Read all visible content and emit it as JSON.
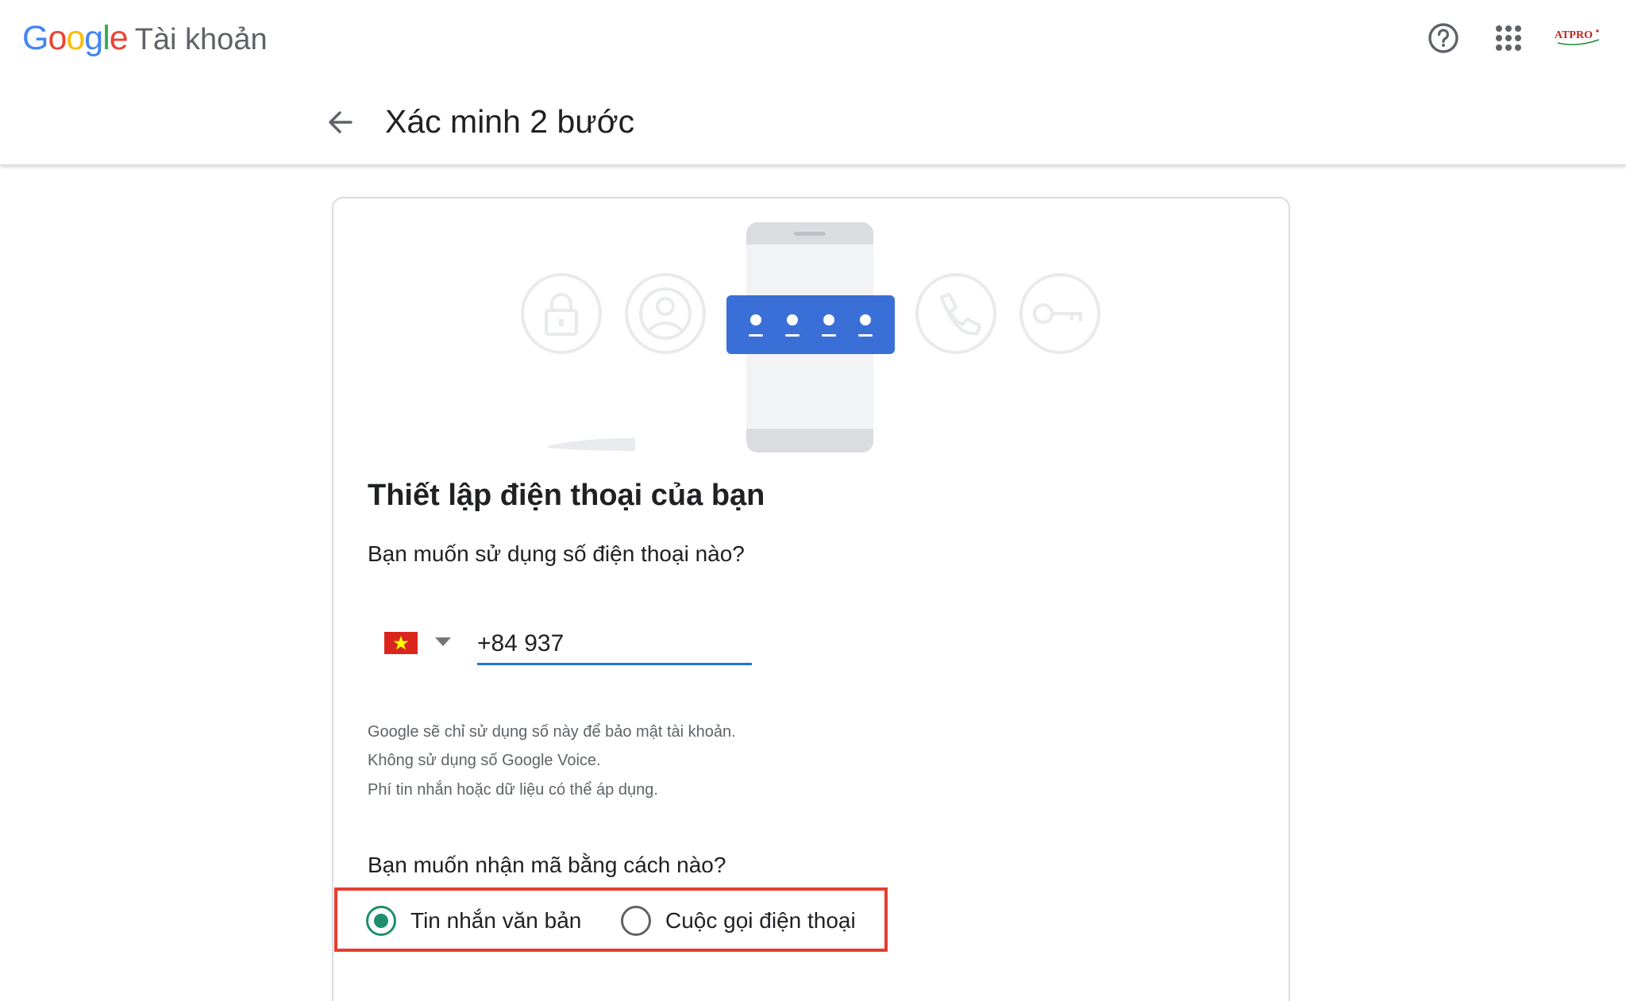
{
  "header": {
    "logo": "Google",
    "product": "Tài khoản",
    "account_badge": "ATPRO"
  },
  "page": {
    "back_label": "←",
    "title": "Xác minh 2 bước"
  },
  "content": {
    "heading": "Thiết lập điện thoại của bạn",
    "phone_question": "Bạn muốn sử dụng số điện thoại nào?",
    "country": "Vietnam",
    "phone_value": "+84 937",
    "notes": [
      "Google sẽ chỉ sử dụng số này để bảo mật tài khoản.",
      "Không sử dụng số Google Voice.",
      "Phí tin nhắn hoặc dữ liệu có thể áp dụng."
    ],
    "code_question": "Bạn muốn nhận mã bằng cách nào?",
    "options": [
      {
        "label": "Tin nhắn văn bản",
        "selected": true
      },
      {
        "label": "Cuộc gọi điện thoại",
        "selected": false
      }
    ]
  },
  "icons": {
    "help": "help-circle-icon",
    "apps": "apps-grid-icon",
    "back": "arrow-back-icon",
    "lock": "lock-icon",
    "profile": "account-circle-icon",
    "phone": "phone-icon",
    "key": "key-icon",
    "flag": "vietnam-flag-icon"
  },
  "colors": {
    "accent_blue": "#1a73e8",
    "radio_selected": "#1e8e6e",
    "highlight": "#e53d2f",
    "code_card": "#3b6fd8",
    "google_blue": "#4285F4",
    "google_red": "#EA4335",
    "google_yellow": "#FBBC05",
    "google_green": "#34A853"
  }
}
